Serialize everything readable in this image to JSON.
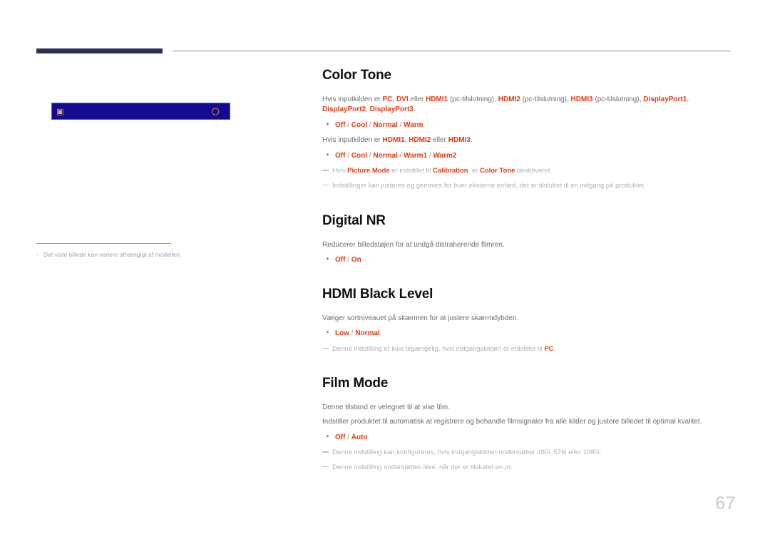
{
  "page": {
    "number": "67",
    "language": "da"
  },
  "left_column": {
    "osd_figure": {
      "left_icon": "lock-icon",
      "right_icon": "power-icon",
      "background_color": "#140a91",
      "icon_color": "#f5b41e"
    },
    "footnote": {
      "dash": "-",
      "text": "Det viste billede kan variere afhængigt af modellen."
    }
  },
  "sections": [
    {
      "id": "color-tone",
      "title": "Color Tone",
      "paragraph_1": {
        "prefix": "Hvis inputkilden er ",
        "runs": [
          {
            "t": "PC",
            "hl": true
          },
          {
            "t": ", ",
            "hl": false
          },
          {
            "t": "DVI",
            "hl": true
          },
          {
            "t": " eller ",
            "hl": false
          },
          {
            "t": "HDMI1",
            "hl": true
          },
          {
            "t": " (pc-tilslutning), ",
            "hl": false
          },
          {
            "t": "HDMI2",
            "hl": true
          },
          {
            "t": " (pc-tilslutning), ",
            "hl": false
          },
          {
            "t": "HDMI3",
            "hl": true
          },
          {
            "t": " (pc-tilslutning), ",
            "hl": false
          },
          {
            "t": "DisplayPort1",
            "hl": true
          },
          {
            "t": ", ",
            "hl": false
          },
          {
            "t": "DisplayPort2",
            "hl": true
          },
          {
            "t": ", ",
            "hl": false
          },
          {
            "t": "DisplayPort3",
            "hl": true
          },
          {
            "t": ".",
            "hl": false
          }
        ]
      },
      "options_1": [
        "Off",
        "Cool",
        "Normal",
        "Warm"
      ],
      "paragraph_2": {
        "prefix": "Hvis inputkilden er ",
        "runs": [
          {
            "t": "HDMI1",
            "hl": true
          },
          {
            "t": ", ",
            "hl": false
          },
          {
            "t": "HDMI2",
            "hl": true
          },
          {
            "t": " eller ",
            "hl": false
          },
          {
            "t": "HDMI3",
            "hl": true
          },
          {
            "t": ".",
            "hl": false
          }
        ]
      },
      "options_2": [
        "Off",
        "Cool",
        "Normal",
        "Warm1",
        "Warm2"
      ],
      "notes": [
        [
          {
            "t": "Hvis ",
            "hl": false
          },
          {
            "t": "Picture Mode",
            "hl": true
          },
          {
            "t": " er indstillet til ",
            "hl": false
          },
          {
            "t": "Calibration",
            "hl": true
          },
          {
            "t": ", er ",
            "hl": false
          },
          {
            "t": "Color Tone",
            "hl": true
          },
          {
            "t": " deaktiveret.",
            "hl": false
          }
        ],
        [
          {
            "t": "Indstillinger kan justeres og gemmes for hver eksterne enhed, der er tilsluttet til en indgang på produktet.",
            "hl": false
          }
        ]
      ]
    },
    {
      "id": "digital-nr",
      "title": "Digital NR",
      "paragraph_1": {
        "prefix": "Reducerer billedstøjen for at undgå distraherende flimren.",
        "runs": []
      },
      "options_1": [
        "Off",
        "On"
      ],
      "notes": []
    },
    {
      "id": "hdmi-black-level",
      "title": "HDMI Black Level",
      "paragraph_1": {
        "prefix": "Vælger sortniveauet på skærmen for at justere skærmdybden.",
        "runs": []
      },
      "options_1": [
        "Low",
        "Normal"
      ],
      "notes": [
        [
          {
            "t": "Denne indstilling er ikke tilgængelig, hvis indgangskilden er indstillet til ",
            "hl": false
          },
          {
            "t": "PC",
            "hl": true
          },
          {
            "t": ".",
            "hl": false
          }
        ]
      ]
    },
    {
      "id": "film-mode",
      "title": "Film Mode",
      "paragraph_1": {
        "prefix": "Denne tilstand er velegnet til at vise film.",
        "runs": []
      },
      "paragraph_2": {
        "prefix": "Indstiller produktet til automatisk at registrere og behandle filmsignaler fra alle kilder og justere billedet til optimal kvalitet.",
        "runs": []
      },
      "options_1": [
        "Off",
        "Auto"
      ],
      "notes": [
        [
          {
            "t": "Denne indstilling kan konfigureres, hvis indgangskilden understøtter 480i, 576i eller 1080i.",
            "hl": false
          }
        ],
        [
          {
            "t": "Denne indstilling understøttes ikke, når der er tilsluttet en pc.",
            "hl": false
          }
        ]
      ]
    }
  ],
  "colors": {
    "highlight": "#e8380d",
    "heading": "#111111",
    "body": "#6d6d6d",
    "note": "#b2b2b2",
    "tab_bar": "#2b3354",
    "osd_blue": "#140a91",
    "page_number": "#c9c9c9"
  }
}
